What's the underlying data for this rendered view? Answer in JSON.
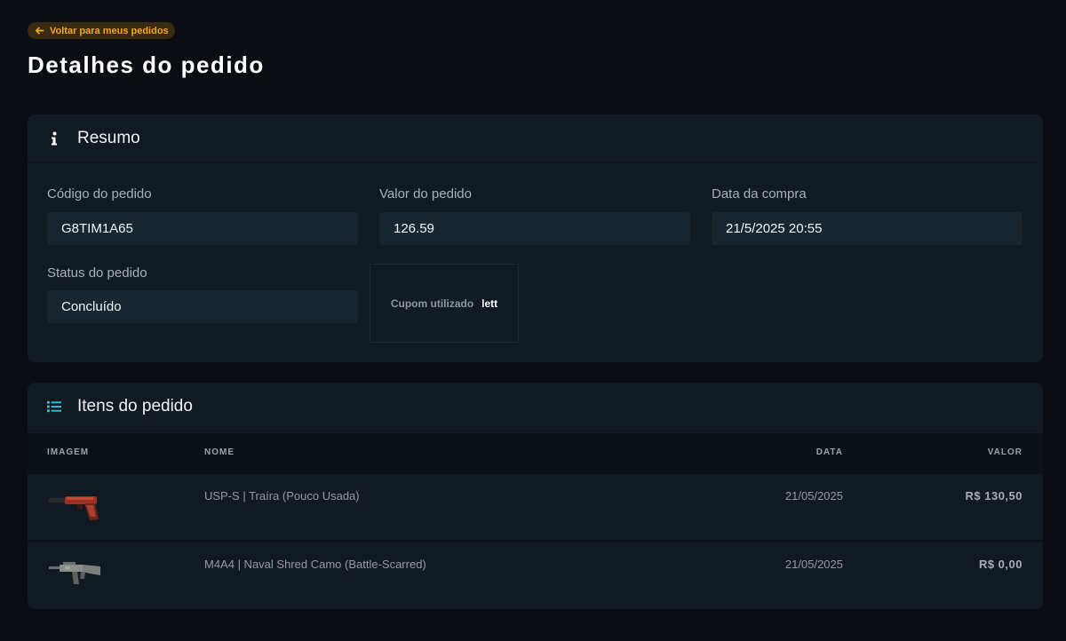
{
  "back_link": {
    "label": "Voltar para meus pedidos"
  },
  "page_title": "Detalhes do pedido",
  "summary": {
    "title": "Resumo",
    "order_code_label": "Código do pedido",
    "order_code": "G8TIM1A65",
    "order_value_label": "Valor do pedido",
    "order_value": "126.59",
    "purchase_date_label": "Data da compra",
    "purchase_date": "21/5/2025 20:55",
    "status_label": "Status do pedido",
    "status": "Concluído",
    "coupon_label": "Cupom utilizado",
    "coupon_value": "lett"
  },
  "items": {
    "title": "Itens do pedido",
    "columns": {
      "image": "IMAGEM",
      "name": "NOME",
      "date": "DATA",
      "value": "VALOR"
    },
    "rows": [
      {
        "name": "USP-S | Traíra (Pouco Usada)",
        "date": "21/05/2025",
        "value": "R$ 130,50",
        "icon": "pistol-image"
      },
      {
        "name": "M4A4 | Naval Shred Camo (Battle-Scarred)",
        "date": "21/05/2025",
        "value": "R$ 0,00",
        "icon": "rifle-image"
      }
    ]
  },
  "colors": {
    "accent": "#f0a824",
    "list_icon": "#2ec4d6",
    "background": "#0a0e13",
    "card": "#111a22"
  }
}
